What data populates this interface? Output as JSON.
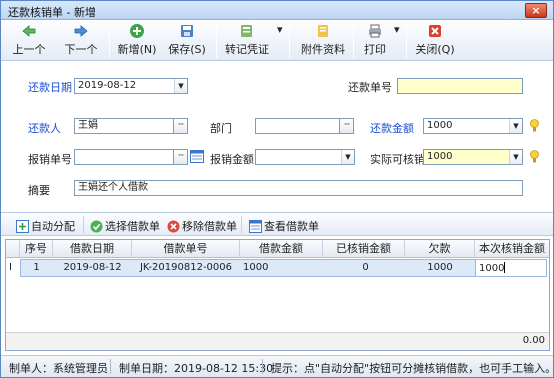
{
  "window": {
    "title": "还款核销单 - 新增",
    "close_glyph": "×"
  },
  "toolbar": {
    "prev": "上一个",
    "next": "下一个",
    "new": "新增(N)",
    "save": "保存(S)",
    "voucher": "转记凭证",
    "attach": "附件资料",
    "print": "打印",
    "close": "关闭(Q)",
    "dropdown_glyph": "▾"
  },
  "form": {
    "repay_date_label": "还款日期",
    "repay_date_value": "2019-08-12",
    "repay_no_label": "还款单号",
    "repay_no_value": "",
    "repayer_label": "还款人",
    "repayer_value": "王娟",
    "dept_label": "部门",
    "dept_value": "",
    "amount_label": "还款金额",
    "amount_value": "1000",
    "claim_no_label": "报销单号",
    "claim_no_value": "",
    "claim_amount_label": "报销金额",
    "claim_amount_value": "",
    "actual_label": "实际可核销",
    "actual_value": "1000",
    "memo_label": "摘要",
    "memo_value": "王娟还个人借款",
    "ellipsis": "···",
    "dropdown_glyph": "▼"
  },
  "subtoolbar": {
    "auto": "自动分配",
    "select": "选择借款单",
    "remove": "移除借款单",
    "view": "查看借款单"
  },
  "grid": {
    "columns": [
      "序号",
      "借款日期",
      "借款单号",
      "借款金额",
      "已核销金额",
      "欠款",
      "本次核销金额"
    ],
    "row_indicator": "I",
    "rows": [
      {
        "seq": "1",
        "date": "2019-08-12",
        "no": "JK-20190812-0006",
        "amount": "1000",
        "written_off": "0",
        "owed": "1000",
        "current": "1000"
      }
    ],
    "total": "0.00"
  },
  "status": {
    "creator": "制单人：系统管理员",
    "create_date": "制单日期：2019-08-12 15:30",
    "hint": "提示：点\"自动分配\"按钮可分摊核销借款，也可手工输入。"
  },
  "colors": {
    "accent_label": "#1a4fd0",
    "required_bg": "#ffffcc",
    "title_bg": "#bcd5f3"
  }
}
